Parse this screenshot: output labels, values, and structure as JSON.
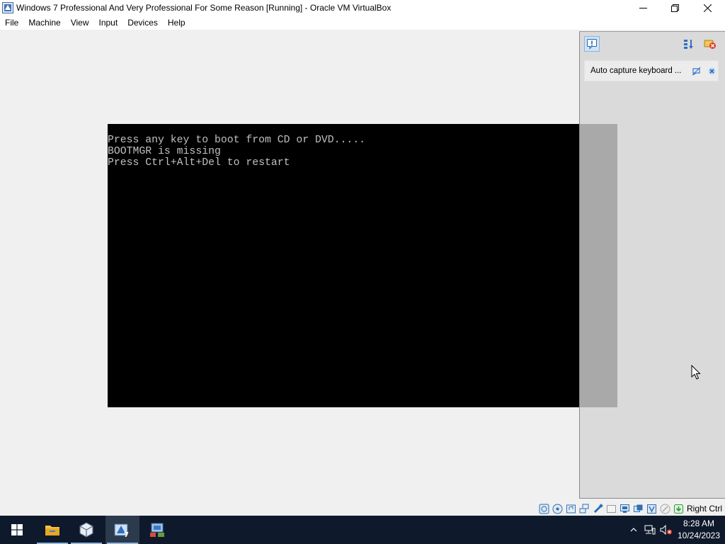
{
  "window": {
    "title": "Windows 7 Professional And Very Professional For Some Reason [Running] - Oracle VM VirtualBox"
  },
  "menu": {
    "items": [
      "File",
      "Machine",
      "View",
      "Input",
      "Devices",
      "Help"
    ]
  },
  "guest_console": {
    "lines": [
      "Press any key to boot from CD or DVD.....",
      "BOOTMGR is missing",
      "Press Ctrl+Alt+Del to restart"
    ]
  },
  "notification_panel": {
    "message": "Auto capture keyboard ..."
  },
  "status_bar": {
    "icons": [
      "hard-disk-icon",
      "optical-drive-icon",
      "audio-icon",
      "network-icon",
      "usb-icon",
      "shared-folders-icon",
      "display-icon",
      "recording-icon",
      "cpu-icon",
      "mouse-integration-icon",
      "keyboard-icon"
    ],
    "host_key": "Right Ctrl"
  },
  "taskbar": {
    "time": "8:28 AM",
    "date": "10/24/2023",
    "apps": [
      "start-button",
      "file-explorer",
      "virtualbox-manager",
      "virtualbox-vm-window",
      "network-app"
    ]
  },
  "colors": {
    "taskbar": "#0e1a2b",
    "console_text": "#c0c0c0",
    "accent": "#1e7fd8"
  }
}
